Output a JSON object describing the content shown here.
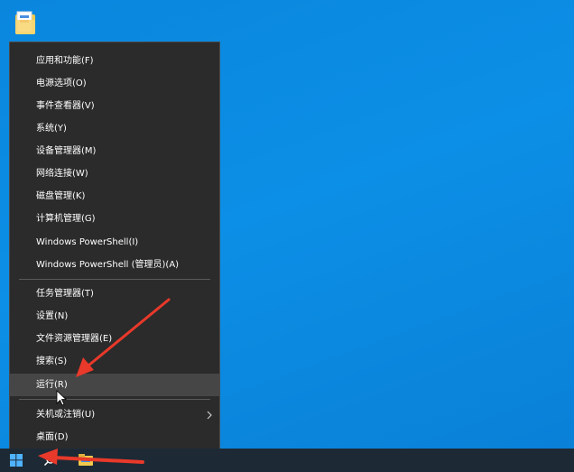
{
  "menu": {
    "items": [
      {
        "label": "应用和功能(F)"
      },
      {
        "label": "电源选项(O)"
      },
      {
        "label": "事件查看器(V)"
      },
      {
        "label": "系统(Y)"
      },
      {
        "label": "设备管理器(M)"
      },
      {
        "label": "网络连接(W)"
      },
      {
        "label": "磁盘管理(K)"
      },
      {
        "label": "计算机管理(G)"
      },
      {
        "label": "Windows PowerShell(I)"
      },
      {
        "label": "Windows PowerShell (管理员)(A)"
      },
      {
        "label": "任务管理器(T)"
      },
      {
        "label": "设置(N)"
      },
      {
        "label": "文件资源管理器(E)"
      },
      {
        "label": "搜索(S)"
      },
      {
        "label": "运行(R)"
      },
      {
        "label": "关机或注销(U)"
      },
      {
        "label": "桌面(D)"
      }
    ],
    "highlighted_item": "运行(R)",
    "submenu_icon": "chevron-right-icon"
  },
  "taskbar": {
    "start_icon": "windows-logo-icon",
    "search_icon": "search-icon",
    "explorer_icon": "file-explorer-icon"
  },
  "desktop": {
    "icon": "folder-icon"
  },
  "annotations": {
    "color": "#e8392a",
    "arrows": [
      "arrow-to-run-item",
      "arrow-to-start-button"
    ]
  },
  "colors": {
    "desktop_blue": "#0a86dd",
    "menu_bg": "#2b2b2b",
    "menu_highlight": "#464646",
    "taskbar_bg": "#1d2a35"
  }
}
